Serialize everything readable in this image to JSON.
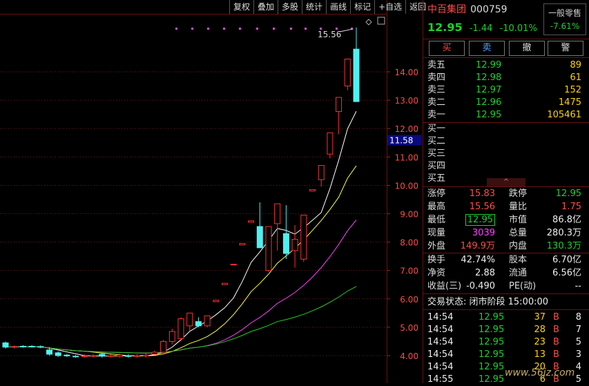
{
  "toolbar": [
    "复权",
    "叠加",
    "多股",
    "统计",
    "画线",
    "标记",
    "+自选",
    "返回"
  ],
  "stock": {
    "name": "中百集团",
    "code": "000759",
    "price": "12.95",
    "change": "-1.44",
    "pct": "-10.01%",
    "tag": "一般零售",
    "tag_pct": "-7.61%"
  },
  "actions": [
    "买",
    "卖",
    "撤",
    "警"
  ],
  "sell": [
    {
      "label": "卖五",
      "price": "12.99",
      "vol": "89"
    },
    {
      "label": "卖四",
      "price": "12.98",
      "vol": "61"
    },
    {
      "label": "卖三",
      "price": "12.97",
      "vol": "152"
    },
    {
      "label": "卖二",
      "price": "12.96",
      "vol": "1475"
    },
    {
      "label": "卖一",
      "price": "12.95",
      "vol": "105461"
    }
  ],
  "buy": [
    "买一",
    "买二",
    "买三",
    "买四",
    "买五"
  ],
  "collapse_icon": "chevron-up-icon",
  "stats": [
    {
      "l1": "涨停",
      "v1": "15.83",
      "c1": "red",
      "l2": "跌停",
      "v2": "12.95",
      "c2": "green"
    },
    {
      "l1": "最高",
      "v1": "15.56",
      "c1": "red",
      "l2": "量比",
      "v2": "1.75",
      "c2": "red"
    },
    {
      "l1": "最低",
      "v1": "12.95",
      "c1": "green",
      "l2": "市值",
      "v2": "86.8亿",
      "c2": "white"
    },
    {
      "l1": "现量",
      "v1": "3039",
      "c1": "mag",
      "l2": "总量",
      "v2": "280.3万",
      "c2": "white"
    },
    {
      "l1": "外盘",
      "v1": "149.9万",
      "c1": "red",
      "l2": "内盘",
      "v2": "130.3万",
      "c2": "green"
    }
  ],
  "stats2": [
    {
      "l1": "换手",
      "v1": "42.74%",
      "l2": "股本",
      "v2": "6.70亿"
    },
    {
      "l1": "净资",
      "v1": "2.88",
      "l2": "流通",
      "v2": "6.56亿"
    },
    {
      "l1": "收益(三)",
      "v1": "-0.490",
      "l2": "PE(动)",
      "v2": "--"
    }
  ],
  "trade_state": "交易状态: 闭市阶段 15:00:00",
  "ticks": [
    {
      "t": "14:54",
      "p": "12.95",
      "v": "37",
      "d": "B",
      "n": "8"
    },
    {
      "t": "14:54",
      "p": "12.95",
      "v": "28",
      "d": "B",
      "n": "7"
    },
    {
      "t": "14:54",
      "p": "12.95",
      "v": "23",
      "d": "B",
      "n": "5"
    },
    {
      "t": "14:54",
      "p": "12.95",
      "v": "13",
      "d": "B",
      "n": "3"
    },
    {
      "t": "14:54",
      "p": "12.95",
      "v": "20",
      "d": "B",
      "n": "4"
    },
    {
      "t": "14:55",
      "p": "12.95",
      "v": "6",
      "d": "B",
      "n": "5"
    }
  ],
  "watermark": "www.56jz.com",
  "chart_data": {
    "type": "candlestick",
    "yticks": [
      "14.00",
      "13.00",
      "12.00",
      "11.00",
      "10.00",
      "9.00",
      "8.00",
      "7.00",
      "6.00",
      "5.00",
      "4.00"
    ],
    "ylim": [
      3.6,
      15.9
    ],
    "current_price_label": "11.58",
    "high_label": "15.56",
    "candles": [
      {
        "o": 4.45,
        "c": 4.3,
        "h": 4.5,
        "l": 4.25
      },
      {
        "o": 4.3,
        "c": 4.32,
        "h": 4.36,
        "l": 4.25
      },
      {
        "o": 4.33,
        "c": 4.32,
        "h": 4.37,
        "l": 4.28
      },
      {
        "o": 4.33,
        "c": 4.31,
        "h": 4.37,
        "l": 4.28
      },
      {
        "o": 4.32,
        "c": 4.31,
        "h": 4.36,
        "l": 4.26
      },
      {
        "o": 4.2,
        "c": 4.05,
        "h": 4.3,
        "l": 4.0
      },
      {
        "o": 4.1,
        "c": 4.0,
        "h": 4.15,
        "l": 3.95
      },
      {
        "o": 4.02,
        "c": 3.99,
        "h": 4.06,
        "l": 3.95
      },
      {
        "o": 3.98,
        "c": 3.97,
        "h": 4.02,
        "l": 3.93
      },
      {
        "o": 3.97,
        "c": 3.99,
        "h": 4.05,
        "l": 3.93
      },
      {
        "o": 3.98,
        "c": 4.0,
        "h": 4.05,
        "l": 3.93
      },
      {
        "o": 4.05,
        "c": 3.98,
        "h": 4.1,
        "l": 3.93
      },
      {
        "o": 3.97,
        "c": 4.0,
        "h": 4.05,
        "l": 3.93
      },
      {
        "o": 3.97,
        "c": 4.02,
        "h": 4.08,
        "l": 3.93
      },
      {
        "o": 4.0,
        "c": 3.97,
        "h": 4.05,
        "l": 3.93
      },
      {
        "o": 3.97,
        "c": 4.0,
        "h": 4.05,
        "l": 3.93
      },
      {
        "o": 3.98,
        "c": 4.02,
        "h": 4.08,
        "l": 3.93
      },
      {
        "o": 4.05,
        "c": 4.12,
        "h": 4.18,
        "l": 4.02
      },
      {
        "o": 4.12,
        "c": 4.5,
        "h": 4.55,
        "l": 4.1
      },
      {
        "o": 4.5,
        "c": 4.85,
        "h": 4.95,
        "l": 4.4
      },
      {
        "o": 4.6,
        "c": 5.3,
        "h": 5.35,
        "l": 4.5
      },
      {
        "o": 5.05,
        "c": 5.5,
        "h": 5.5,
        "l": 4.85
      },
      {
        "o": 5.2,
        "c": 5.05,
        "h": 5.35,
        "l": 5.0
      },
      {
        "o": 5.05,
        "c": 5.4,
        "h": 5.4,
        "l": 5.0
      },
      {
        "o": 5.9,
        "c": 5.95,
        "h": 5.96,
        "l": 5.9
      },
      {
        "o": 6.5,
        "c": 6.55,
        "h": 6.56,
        "l": 6.5
      },
      {
        "o": 7.2,
        "c": 7.22,
        "h": 7.23,
        "l": 7.2
      },
      {
        "o": 7.9,
        "c": 7.95,
        "h": 7.96,
        "l": 7.9
      },
      {
        "o": 8.7,
        "c": 8.75,
        "h": 8.75,
        "l": 8.7
      },
      {
        "o": 8.55,
        "c": 7.8,
        "h": 9.4,
        "l": 7.8
      },
      {
        "o": 7.0,
        "c": 8.55,
        "h": 8.55,
        "l": 6.95
      },
      {
        "o": 8.65,
        "c": 9.35,
        "h": 9.35,
        "l": 7.7
      },
      {
        "o": 8.3,
        "c": 7.6,
        "h": 9.3,
        "l": 7.4
      },
      {
        "o": 7.7,
        "c": 8.1,
        "h": 8.6,
        "l": 7.1
      },
      {
        "o": 7.4,
        "c": 8.95,
        "h": 8.95,
        "l": 7.3
      },
      {
        "o": 9.8,
        "c": 9.85,
        "h": 9.85,
        "l": 9.8
      },
      {
        "o": 10.2,
        "c": 10.7,
        "h": 10.7,
        "l": 9.95
      },
      {
        "o": 11.1,
        "c": 11.85,
        "h": 11.85,
        "l": 10.95
      },
      {
        "o": 12.6,
        "c": 13.1,
        "h": 13.1,
        "l": 11.8
      },
      {
        "o": 13.5,
        "c": 14.45,
        "h": 14.45,
        "l": 13.35
      },
      {
        "o": 14.8,
        "c": 12.95,
        "h": 15.56,
        "l": 12.95
      }
    ]
  }
}
